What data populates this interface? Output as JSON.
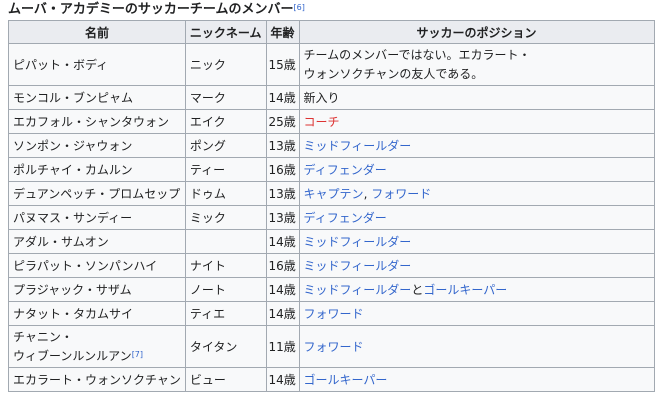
{
  "caption": {
    "text": "ムーバ・アカデミーのサッカーチームのメンバー",
    "ref": "[6]"
  },
  "headers": [
    "名前",
    "ニックネーム",
    "年齢",
    "サッカーのポジション"
  ],
  "rows": [
    {
      "name": "ピパット・ボディ",
      "nick": "ニック",
      "age": "15歳",
      "pos_note_line1": "チームのメンバーではない。エカラート・",
      "pos_note_line2": "ウォンソクチャンの友人である。"
    },
    {
      "name": "モンコル・ブンピャム",
      "nick": "マーク",
      "age": "14歳",
      "pos_plain": "新入り"
    },
    {
      "name": "エカフォル・シャンタウォン",
      "nick": "エイク",
      "age": "25歳",
      "pos_red": "コーチ"
    },
    {
      "name": "ソンポン・ジャウォン",
      "nick": "ポング",
      "age": "13歳",
      "pos_link1": "ミッドフィールダー"
    },
    {
      "name": "ポルチャイ・カムルン",
      "nick": "ティー",
      "age": "16歳",
      "pos_link1": "ディフェンダー"
    },
    {
      "name": "デュアンペッチ・プロムセップ",
      "nick": "ドゥム",
      "age": "13歳",
      "pos_link1": "キャプテン",
      "pos_sep": ", ",
      "pos_link2": "フォワード"
    },
    {
      "name": "パヌマス・サンディー",
      "nick": "ミック",
      "age": "13歳",
      "pos_link1": "ディフェンダー"
    },
    {
      "name": "アダル・サムオン",
      "nick": "",
      "age": "14歳",
      "pos_link1": "ミッドフィールダー"
    },
    {
      "name": "ピラパット・ソンパンハイ",
      "nick": "ナイト",
      "age": "16歳",
      "pos_link1": "ミッドフィールダー"
    },
    {
      "name": "プラジャック・サザム",
      "nick": "ノート",
      "age": "14歳",
      "pos_link1": "ミッドフィールダー",
      "pos_sep": "と",
      "pos_link2": "ゴールキーパー"
    },
    {
      "name": "ナタット・タカムサイ",
      "nick": "ティエ",
      "age": "14歳",
      "pos_link1": "フォワード"
    },
    {
      "name_line1": "チャニン・",
      "name_line2": "ウィブーンルンルアン",
      "name_ref": "[7]",
      "nick": "タイタン",
      "age": "11歳",
      "pos_link1": "フォワード"
    },
    {
      "name": "エカラート・ウォンソクチャン",
      "nick": "ビュー",
      "age": "14歳",
      "pos_link1": "ゴールキーパー"
    }
  ]
}
